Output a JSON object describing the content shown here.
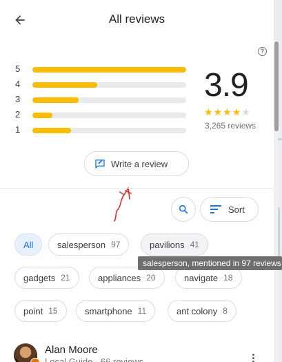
{
  "header": {
    "title": "All reviews"
  },
  "summary": {
    "rating": "3.9",
    "stars_filled": 4,
    "stars_total": 5,
    "review_count": "3,265 reviews",
    "help_icon": "?",
    "distribution": [
      {
        "label": "5",
        "fraction": 1.0
      },
      {
        "label": "4",
        "fraction": 0.42
      },
      {
        "label": "3",
        "fraction": 0.3
      },
      {
        "label": "2",
        "fraction": 0.13
      },
      {
        "label": "1",
        "fraction": 0.25
      }
    ]
  },
  "actions": {
    "write_review_label": "Write a review",
    "sort_label": "Sort"
  },
  "chips": [
    {
      "label": "All",
      "count": "",
      "selected": true
    },
    {
      "label": "salesperson",
      "count": "97"
    },
    {
      "label": "pavilions",
      "count": "41",
      "hovered": true
    },
    {
      "label": "gadgets",
      "count": "21"
    },
    {
      "label": "appliances",
      "count": "20"
    },
    {
      "label": "navigate",
      "count": "18"
    },
    {
      "label": "point",
      "count": "15"
    },
    {
      "label": "smartphone",
      "count": "11"
    },
    {
      "label": "ant colony",
      "count": "8"
    }
  ],
  "tooltip": {
    "text": "salesperson, mentioned in 97 reviews"
  },
  "reviewer": {
    "name": "Alan Moore",
    "meta": "Local Guide · 66 reviews"
  },
  "icons": {
    "back": "arrow-back-icon",
    "write": "edit-review-icon",
    "search": "search-icon",
    "sort": "sort-icon",
    "more": "more-vert-icon"
  },
  "colors": {
    "star": "#fbbc04",
    "accent": "#1a73e8",
    "annotation": "#d93025"
  }
}
